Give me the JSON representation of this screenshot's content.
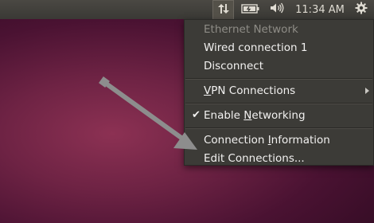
{
  "tray": {
    "network_icon": "network-updown-icon",
    "battery_icon": "battery-icon",
    "volume_icon": "volume-icon",
    "clock": "11:34 AM",
    "session_icon": "gear-power-icon"
  },
  "menu": {
    "section_header": "Ethernet Network",
    "wired": "Wired connection 1",
    "disconnect": "Disconnect",
    "vpn_pre": "",
    "vpn_u": "V",
    "vpn_post": "PN Connections",
    "enable_pre": "Enable ",
    "enable_u": "N",
    "enable_post": "etworking",
    "info_pre": "Connection ",
    "info_u": "I",
    "info_post": "nformation",
    "edit": "Edit Connections..."
  },
  "colors": {
    "menu_bg": "#3c3b37",
    "panel_bg": "#3f3e3a",
    "arrow": "#8d8d8d"
  }
}
